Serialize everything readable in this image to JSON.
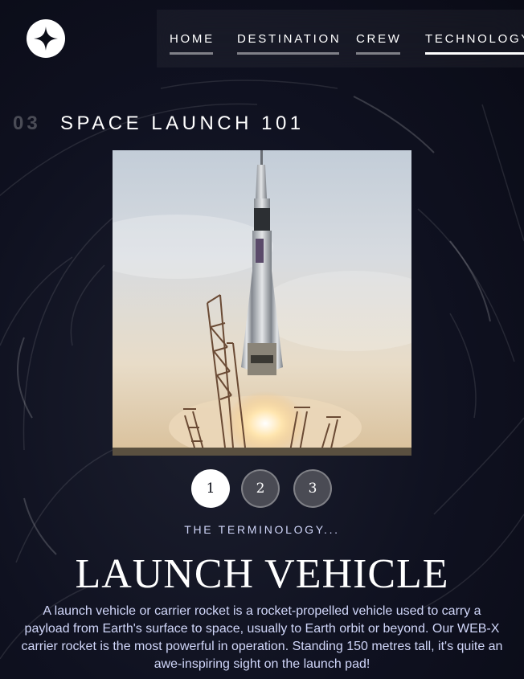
{
  "nav": {
    "items": [
      {
        "label": "HOME"
      },
      {
        "label": "DESTINATION"
      },
      {
        "label": "CREW"
      },
      {
        "label": "TECHNOLOGY"
      }
    ],
    "active": "TECHNOLOGY"
  },
  "heading": {
    "number": "03",
    "title": "SPACE LAUNCH 101"
  },
  "pager": {
    "buttons": [
      "1",
      "2",
      "3"
    ],
    "active": "1"
  },
  "technology": {
    "eyebrow": "THE TERMINOLOGY...",
    "name": "LAUNCH VEHICLE",
    "description": "A launch vehicle or carrier rocket is a rocket-propelled vehicle used to carry a payload from Earth's surface to space, usually to Earth orbit or beyond. Our WEB-X carrier rocket is the most powerful in operation. Standing 150 metres tall, it's quite an awe-inspiring sight on the launch pad!"
  },
  "icons": {
    "logo": "star-logo-icon"
  },
  "colors": {
    "background": "#0b0d17",
    "accent_light": "#d0d6f9",
    "white": "#ffffff"
  }
}
